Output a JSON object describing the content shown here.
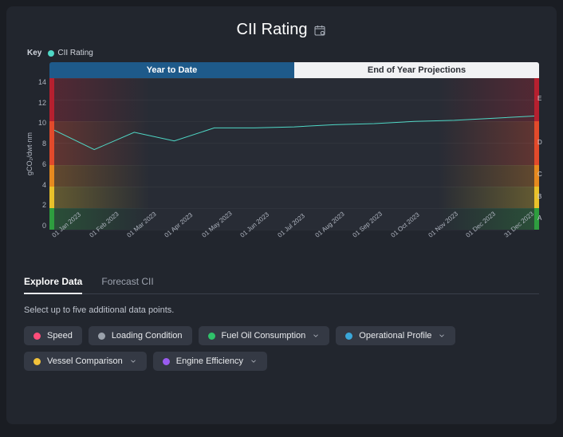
{
  "header": {
    "title": "CII Rating",
    "key_label": "Key",
    "series_name": "CII Rating",
    "series_color": "#4fd8c6"
  },
  "chart_tabs": {
    "active": "Year to Date",
    "inactive": "End of Year Projections"
  },
  "chart_data": {
    "type": "line",
    "title": "CII Rating",
    "ylabel": "gCO₂/dwt·nm",
    "ylim": [
      0,
      14
    ],
    "y_ticks": [
      14,
      12,
      10,
      8,
      6,
      4,
      2,
      0
    ],
    "categories": [
      "01 Jan 2023",
      "01 Feb 2023",
      "01 Mar 2023",
      "01 Apr 2023",
      "01 May 2023",
      "01 Jun 2023",
      "01 Jul 2023",
      "01 Aug 2023",
      "01 Sep 2023",
      "01 Oct 2023",
      "01 Nov 2023",
      "01 Dec 2023",
      "31 Dec 2023"
    ],
    "series": [
      {
        "name": "CII Rating",
        "color": "#4fd8c6",
        "values": [
          9.2,
          7.4,
          9.0,
          8.2,
          9.4,
          9.4,
          9.5,
          9.7,
          9.8,
          10.0,
          10.1,
          10.3,
          10.5
        ]
      }
    ],
    "rating_bands": [
      {
        "label": "E",
        "range": [
          10,
          14
        ],
        "color": "#b6202f"
      },
      {
        "label": "D",
        "range": [
          6,
          10
        ],
        "color": "#e24a2b"
      },
      {
        "label": "C",
        "range": [
          4,
          6
        ],
        "color": "#e68a1f"
      },
      {
        "label": "B",
        "range": [
          2,
          4
        ],
        "color": "#e9c22a"
      },
      {
        "label": "A",
        "range": [
          0,
          2
        ],
        "color": "#2e9e3f"
      }
    ]
  },
  "section_tabs": {
    "explore": "Explore Data",
    "forecast": "Forecast CII"
  },
  "helper_text": "Select up to five additional data points.",
  "chips": [
    {
      "name": "speed",
      "label": "Speed",
      "color": "#ff4d7a",
      "dropdown": false
    },
    {
      "name": "loading-condition",
      "label": "Loading Condition",
      "color": "#9aa1ab",
      "dropdown": false
    },
    {
      "name": "fuel-oil-consumption",
      "label": "Fuel Oil Consumption",
      "color": "#2fc26a",
      "dropdown": true
    },
    {
      "name": "operational-profile",
      "label": "Operational Profile",
      "color": "#3aa7d9",
      "dropdown": true
    },
    {
      "name": "vessel-comparison",
      "label": "Vessel Comparison",
      "color": "#f2c23a",
      "dropdown": true
    },
    {
      "name": "engine-efficiency",
      "label": "Engine Efficiency",
      "color": "#9a5cf0",
      "dropdown": true
    }
  ]
}
